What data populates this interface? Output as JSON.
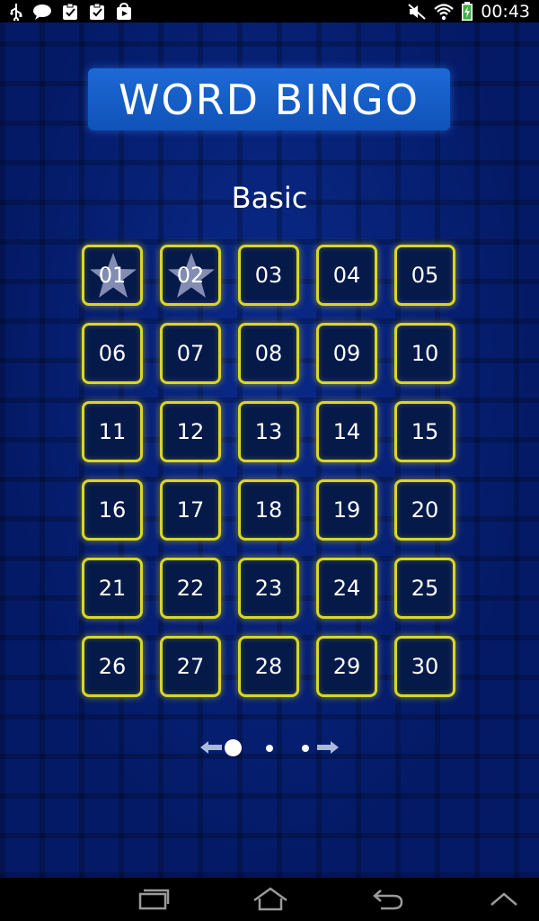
{
  "status_bar": {
    "time": "00:43",
    "left_icons": [
      "usb-icon",
      "chat-bubble-icon",
      "clipboard-check-icon",
      "clipboard-check-icon",
      "play-store-icon"
    ],
    "right_icons": [
      "mute-icon",
      "wifi-icon",
      "battery-charging-icon"
    ]
  },
  "header": {
    "title": "WORD BINGO"
  },
  "level": {
    "name": "Basic"
  },
  "levels": [
    {
      "label": "01",
      "starred": true
    },
    {
      "label": "02",
      "starred": true
    },
    {
      "label": "03",
      "starred": false
    },
    {
      "label": "04",
      "starred": false
    },
    {
      "label": "05",
      "starred": false
    },
    {
      "label": "06",
      "starred": false
    },
    {
      "label": "07",
      "starred": false
    },
    {
      "label": "08",
      "starred": false
    },
    {
      "label": "09",
      "starred": false
    },
    {
      "label": "10",
      "starred": false
    },
    {
      "label": "11",
      "starred": false
    },
    {
      "label": "12",
      "starred": false
    },
    {
      "label": "13",
      "starred": false
    },
    {
      "label": "14",
      "starred": false
    },
    {
      "label": "15",
      "starred": false
    },
    {
      "label": "16",
      "starred": false
    },
    {
      "label": "17",
      "starred": false
    },
    {
      "label": "18",
      "starred": false
    },
    {
      "label": "19",
      "starred": false
    },
    {
      "label": "20",
      "starred": false
    },
    {
      "label": "21",
      "starred": false
    },
    {
      "label": "22",
      "starred": false
    },
    {
      "label": "23",
      "starred": false
    },
    {
      "label": "24",
      "starred": false
    },
    {
      "label": "25",
      "starred": false
    },
    {
      "label": "26",
      "starred": false
    },
    {
      "label": "27",
      "starred": false
    },
    {
      "label": "28",
      "starred": false
    },
    {
      "label": "29",
      "starred": false
    },
    {
      "label": "30",
      "starred": false
    }
  ],
  "pager": {
    "page_count": 3,
    "current_page": 1
  },
  "nav_bar": {
    "buttons": [
      "recent-apps-icon",
      "home-icon",
      "back-icon",
      "up-chevron-icon"
    ]
  },
  "colors": {
    "background": "#041a66",
    "title_box": "#1a62cc",
    "cell_border": "#d9d627",
    "star": "#8a94b8"
  }
}
